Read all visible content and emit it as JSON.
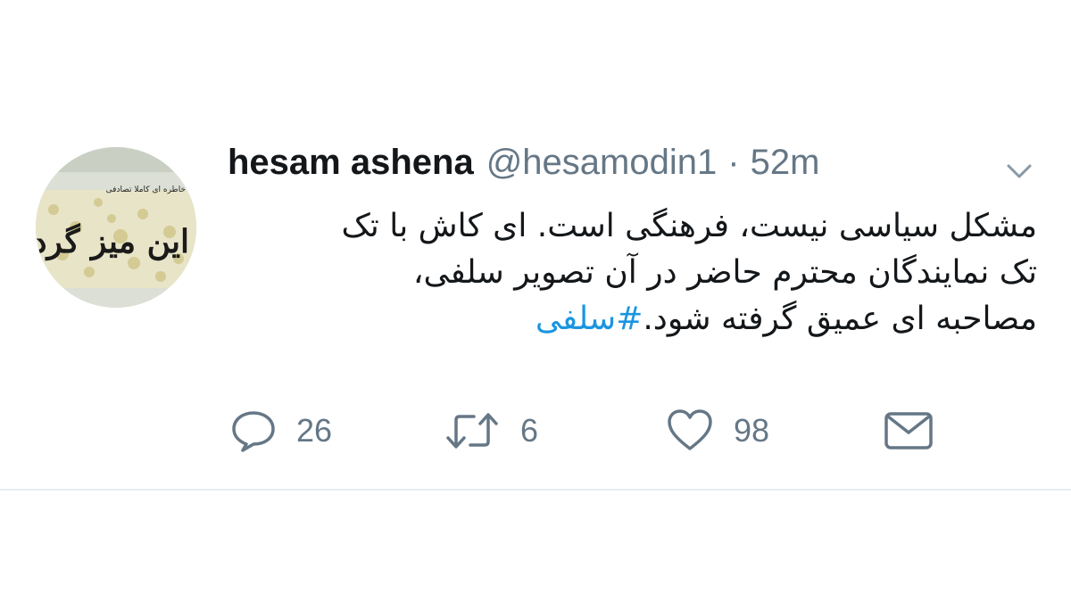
{
  "tweet": {
    "display_name": "hesam ashena",
    "handle": "@hesamodin1",
    "separator": "·",
    "time": "52m",
    "text_line1": "مشکل سیاسی نیست، فرهنگی است. ای کاش با تک",
    "text_line2": "تک نمایندگان محترم حاضر در آن تصویر سلفی،",
    "text_line3": "مصاحبه ای عمیق گرفته شود.",
    "hashtag": "#سلفی",
    "avatar_text_large": "این میز گرد",
    "avatar_text_small": "خاطره ای کاملا تصادفی"
  },
  "actions": {
    "reply": {
      "icon": "reply-icon",
      "count": "26"
    },
    "retweet": {
      "icon": "retweet-icon",
      "count": "6"
    },
    "like": {
      "icon": "heart-icon",
      "count": "98"
    },
    "message": {
      "icon": "envelope-icon"
    }
  },
  "colors": {
    "text": "#14171a",
    "muted": "#657786",
    "link": "#1b95e0",
    "divider": "#e6ecf0"
  }
}
